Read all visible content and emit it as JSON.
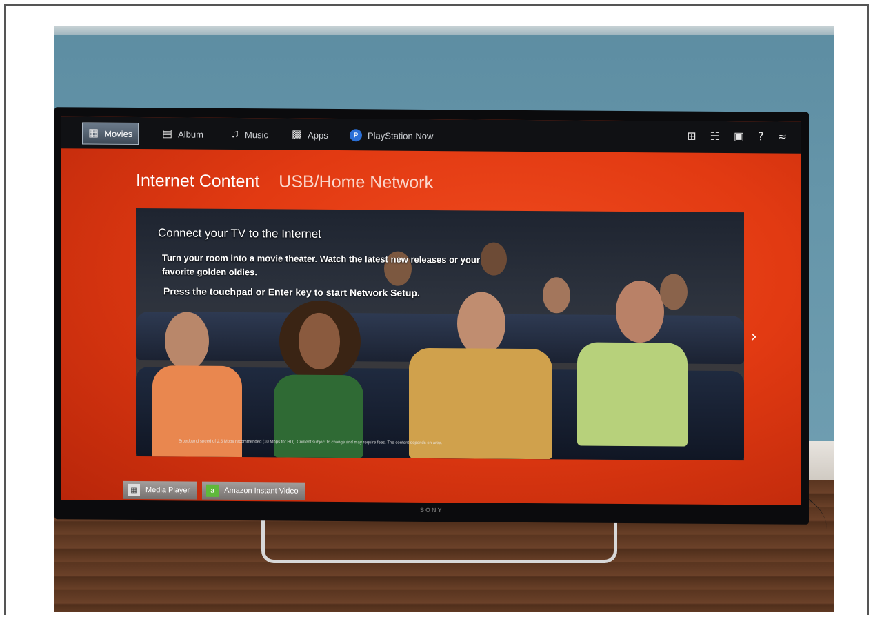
{
  "nav": {
    "items": [
      {
        "label": "Movies",
        "icon": "film-icon"
      },
      {
        "label": "Album",
        "icon": "photo-icon"
      },
      {
        "label": "Music",
        "icon": "music-note-icon"
      },
      {
        "label": "Apps",
        "icon": "apps-grid-icon"
      },
      {
        "label": "PlayStation Now",
        "icon": "playstation-icon"
      }
    ],
    "right_icons": [
      "input-icon",
      "network-icon",
      "toolbox-icon",
      "help-icon",
      "wifi-off-icon"
    ]
  },
  "tabs": {
    "active": "Internet Content",
    "other": "USB/Home Network"
  },
  "hero": {
    "title": "Connect your TV to the Internet",
    "description": "Turn your room into a movie theater. Watch the latest new releases or your favorite golden oldies.",
    "press": "Press the touchpad or Enter key to start Network Setup.",
    "disclaimer": "Broadband speed of 2.5 Mbps recommended (10 Mbps for HD). Content subject to change and may require fees. The content depends on area."
  },
  "bottom_apps": [
    {
      "label": "Media Player",
      "icon": "media-player-icon"
    },
    {
      "label": "Amazon Instant Video",
      "icon": "amazon-icon"
    }
  ],
  "brand": "SONY",
  "colors": {
    "accent": "#e23a12",
    "bar": "#101114"
  }
}
